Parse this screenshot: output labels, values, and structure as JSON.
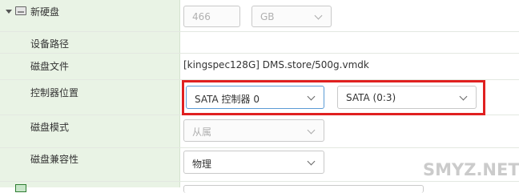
{
  "disk": {
    "title": "新硬盘",
    "size_value": "466",
    "size_unit": "GB"
  },
  "rows": {
    "device_path": {
      "label": "设备路径",
      "value": ""
    },
    "disk_file": {
      "label": "磁盘文件",
      "value": "[kingspec128G] DMS.store/500g.vmdk"
    },
    "controller_location": {
      "label": "控制器位置",
      "controller": "SATA 控制器 0",
      "port": "SATA (0:3)"
    },
    "disk_mode": {
      "label": "磁盘模式",
      "value": "从属"
    },
    "disk_compat": {
      "label": "磁盘兼容性",
      "value": "物理"
    }
  },
  "watermark": "SMYZ.NET"
}
